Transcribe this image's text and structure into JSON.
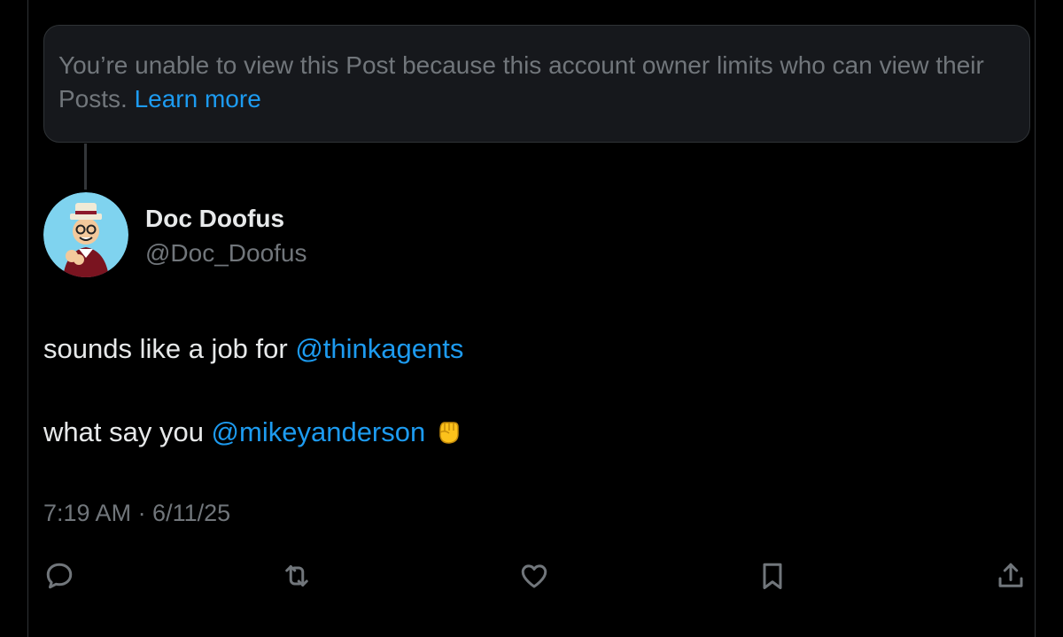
{
  "notice": {
    "text": "You’re unable to view this Post because this account owner limits who can view their Posts.",
    "link_label": "Learn more"
  },
  "author": {
    "display_name": "Doc Doofus",
    "handle": "@Doc_Doofus",
    "avatar_icon": "cartoon-avatar"
  },
  "post": {
    "line1_text": "sounds like a job for ",
    "line1_mention": "@thinkagents",
    "line2_text": "what say you ",
    "line2_mention": "@mikeyanderson",
    "emoji": "✊",
    "timestamp": "7:19 AM · 6/11/25"
  },
  "actions": [
    {
      "name": "reply",
      "icon": "reply-icon"
    },
    {
      "name": "repost",
      "icon": "repost-icon"
    },
    {
      "name": "like",
      "icon": "heart-icon"
    },
    {
      "name": "bookmark",
      "icon": "bookmark-icon"
    },
    {
      "name": "share",
      "icon": "share-icon"
    }
  ],
  "colors": {
    "background": "#000000",
    "accent": "#1d9bf0",
    "secondary_text": "#71767b",
    "primary_text": "#e7e9ea",
    "notice_bg": "#16181c"
  }
}
